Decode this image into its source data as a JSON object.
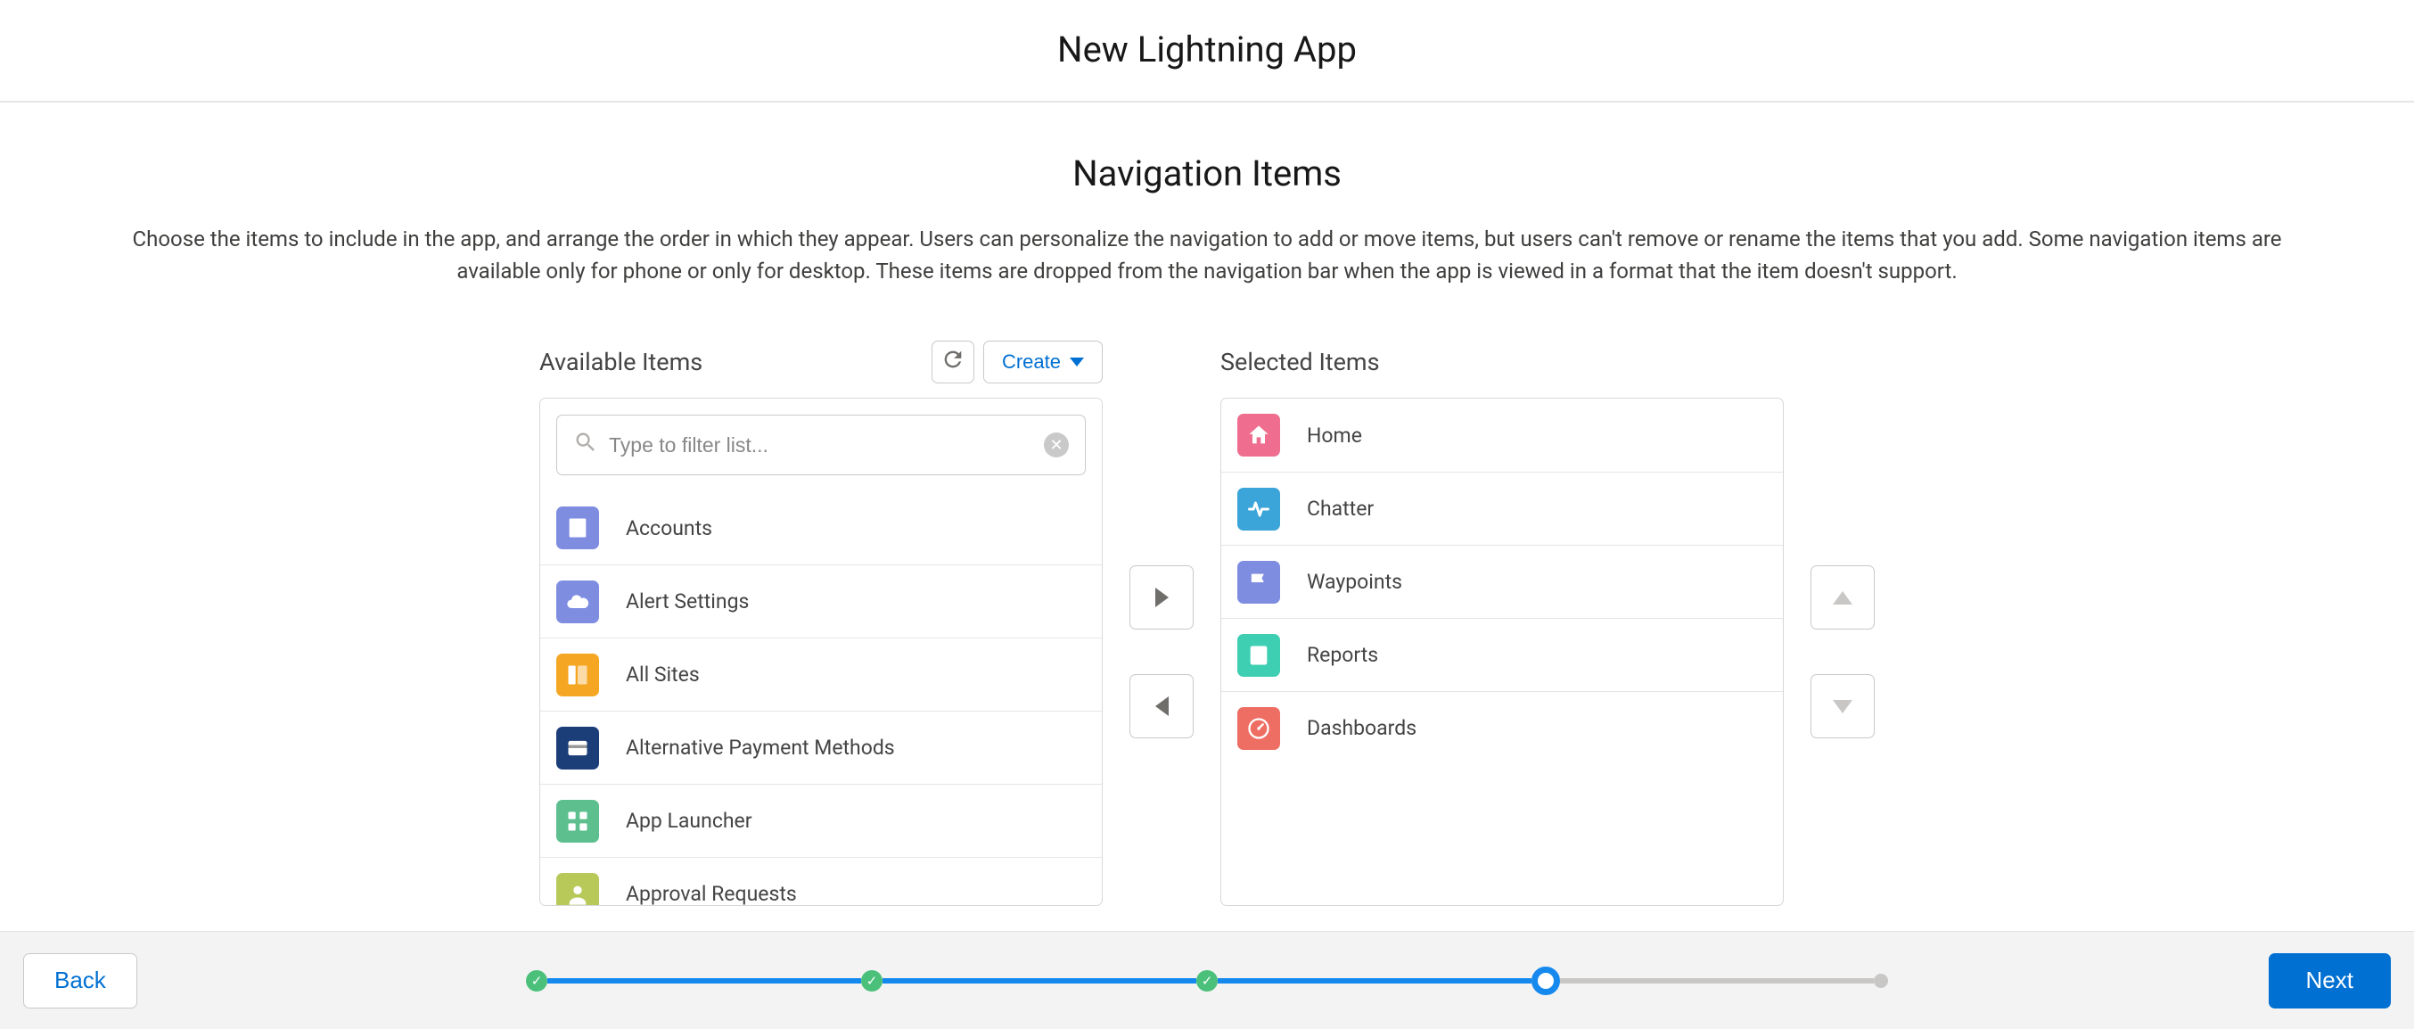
{
  "modal": {
    "title": "New Lightning App"
  },
  "section": {
    "title": "Navigation Items",
    "description": "Choose the items to include in the app, and arrange the order in which they appear. Users can personalize the navigation to add or move items, but users can't remove or rename the items that you add. Some navigation items are available only for phone or only for desktop. These items are dropped from the navigation bar when the app is viewed in a format that the item doesn't support."
  },
  "available": {
    "heading": "Available Items",
    "create_label": "Create",
    "search_placeholder": "Type to filter list...",
    "items": [
      {
        "label": "Accounts",
        "icon_bg": "#7f8de1",
        "icon": "building"
      },
      {
        "label": "Alert Settings",
        "icon_bg": "#7f8de1",
        "icon": "cloud"
      },
      {
        "label": "All Sites",
        "icon_bg": "#f5a623",
        "icon": "layout"
      },
      {
        "label": "Alternative Payment Methods",
        "icon_bg": "#1b3d78",
        "icon": "card"
      },
      {
        "label": "App Launcher",
        "icon_bg": "#5ebf8e",
        "icon": "grid"
      },
      {
        "label": "Approval Requests",
        "icon_bg": "#b8c95a",
        "icon": "person"
      }
    ]
  },
  "selected": {
    "heading": "Selected Items",
    "items": [
      {
        "label": "Home",
        "icon_bg": "#ef6e8f",
        "icon": "home"
      },
      {
        "label": "Chatter",
        "icon_bg": "#3ba4d8",
        "icon": "pulse"
      },
      {
        "label": "Waypoints",
        "icon_bg": "#7f8de1",
        "icon": "flag"
      },
      {
        "label": "Reports",
        "icon_bg": "#3ecfb2",
        "icon": "report"
      },
      {
        "label": "Dashboards",
        "icon_bg": "#ef6e64",
        "icon": "gauge"
      }
    ]
  },
  "footer": {
    "back_label": "Back",
    "next_label": "Next"
  },
  "progress": {
    "steps": [
      "done",
      "done",
      "done",
      "current",
      "future"
    ]
  }
}
